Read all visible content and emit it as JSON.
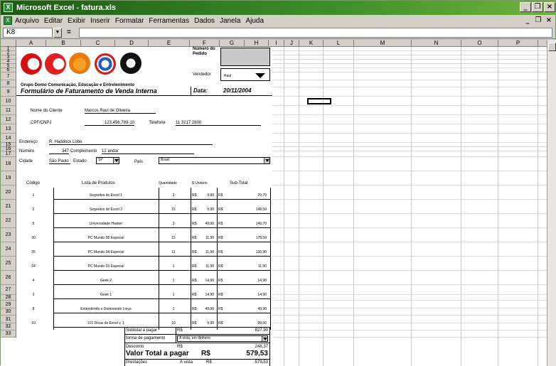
{
  "window": {
    "title": "Microsoft Excel - fatura.xls",
    "app_icon": "excel-icon"
  },
  "menu": [
    "Arquivo",
    "Editar",
    "Exibir",
    "Inserir",
    "Formatar",
    "Ferramentas",
    "Dados",
    "Janela",
    "Ajuda"
  ],
  "formula_bar": {
    "cell_ref": "K8",
    "fx": "=",
    "content": ""
  },
  "columns": [
    "A",
    "B",
    "C",
    "D",
    "E",
    "F",
    "G",
    "H",
    "I",
    "J",
    "K",
    "L",
    "M",
    "N",
    "O",
    "P",
    "Q"
  ],
  "rows": [
    "1",
    "2",
    "3",
    "4",
    "5",
    "6",
    "7",
    "8",
    "9",
    "10",
    "11",
    "12",
    "13",
    "14",
    "15",
    "16",
    "17",
    "18",
    "19",
    "20",
    "21",
    "22",
    "23",
    "24",
    "25",
    "26",
    "27",
    "28",
    "29",
    "30",
    "31",
    "32",
    "33"
  ],
  "form": {
    "numero_pedido": "Número do Pedido",
    "vendedor_label": "Vendedor",
    "vendedor_value": "Raul",
    "company": "Grupo Domo Comunicação, Educação e Entretenimento",
    "form_title": "Formulário de Faturamento de Venda Interna",
    "date_label": "Data:",
    "date_value": "20/11/2004",
    "cliente_label": "Nome do Cliente",
    "cliente_value": "Marcos Raul de Oliveira",
    "cpf_label": "CPF/CNPJ",
    "cpf_value": "123.456.789-10",
    "telefone_label": "Telefone",
    "telefone_value": "11 3217 2600",
    "endereco_label": "Endereço",
    "endereco_value": "R. Haddock Lobo",
    "numero_label": "Número",
    "numero_value": "347",
    "complemento_label": "Complemento",
    "complemento_value": "12 andar",
    "cidade_label": "Cidade",
    "cidade_value": "São Paulo",
    "estado_label": "Estado",
    "estado_value": "SP",
    "pais_label": "País",
    "pais_value": "Brasil",
    "headers": {
      "codigo": "Código",
      "lista": "Lista de Produtos",
      "quantidade": "Quantidade",
      "unitario": "$ Unitário",
      "subtotal": "Sub-Total"
    },
    "products": [
      {
        "codigo": "1",
        "nome": "Segredos do Excel 1",
        "qtd": "3",
        "unit": "9,90",
        "sub": "29,70"
      },
      {
        "codigo": "2",
        "nome": "Segredos do Excel 2",
        "qtd": "15",
        "unit": "9,90",
        "sub": "148,50"
      },
      {
        "codigo": "5",
        "nome": "Universidade Hacker",
        "qtd": "3",
        "unit": "49,90",
        "sub": "149,70"
      },
      {
        "codigo": "30",
        "nome": "PC Mundo 08 Especial",
        "qtd": "15",
        "unit": "11,90",
        "sub": "178,50"
      },
      {
        "codigo": "25",
        "nome": "PC Mundo 04 Especial",
        "qtd": "11",
        "unit": "11,90",
        "sub": "130,90"
      },
      {
        "codigo": "24",
        "nome": "PC Mundo 03 Especial",
        "qtd": "1",
        "unit": "11,90",
        "sub": "11,90"
      },
      {
        "codigo": "4",
        "nome": "Geek 2",
        "qtd": "1",
        "unit": "14,90",
        "sub": "14,90"
      },
      {
        "codigo": "3",
        "nome": "Geek 1",
        "qtd": "1",
        "unit": "14,90",
        "sub": "14,90"
      },
      {
        "codigo": "8",
        "nome": "Entendendo e Dominando Linux",
        "qtd": "1",
        "unit": "49,90",
        "sub": "49,90"
      },
      {
        "codigo": "10",
        "nome": "101 Dicas de Excel v. 1",
        "qtd": "10",
        "unit": "9,90",
        "sub": "99,00"
      }
    ],
    "currency": "R$",
    "subtotal_label": "Subtotal a pagar",
    "subtotal_value": "827,90",
    "pagamento_label": "forma de pagamento",
    "pagamento_value": "À vista, em dinheiro",
    "desconto_label": "Desconto",
    "desconto_value": "248,37",
    "total_label": "Valor Total a pagar",
    "total_value": "579,53",
    "prestacoes_label": "Prestações",
    "prestacoes_tipo": "À vista",
    "prestacoes_value": "579,53"
  }
}
